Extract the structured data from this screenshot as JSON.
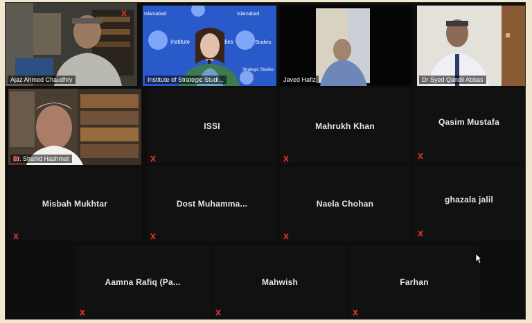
{
  "meeting": {
    "participants": [
      {
        "id": "p1",
        "name": "Ajaz Ahmed Chaudhry",
        "video": true
      },
      {
        "id": "p2",
        "name": "Institute of Strategic Studi...",
        "video": true,
        "active_speaker": true
      },
      {
        "id": "p3",
        "name": "Javed Hafiz",
        "video": true
      },
      {
        "id": "p4",
        "name": "Dr Syed Qandil Abbas",
        "video": true
      },
      {
        "id": "p5",
        "name": "Dr. Shahid Hashmat",
        "video": true,
        "muted": true
      },
      {
        "id": "p6",
        "name": "ISSI",
        "video": false,
        "muted": true
      },
      {
        "id": "p7",
        "name": "Mahrukh Khan",
        "video": false,
        "muted": true
      },
      {
        "id": "p8",
        "name": "Qasim Mustafa",
        "video": false,
        "muted": true
      },
      {
        "id": "p9",
        "name": "Misbah Mukhtar",
        "video": false,
        "muted": true
      },
      {
        "id": "p10",
        "name": "Dost Muhamma...",
        "video": false,
        "muted": true
      },
      {
        "id": "p11",
        "name": "Naela Chohan",
        "video": false,
        "muted": true
      },
      {
        "id": "p12",
        "name": "ghazala jalil",
        "video": false,
        "muted": true
      },
      {
        "id": "p13",
        "name": "Aamna Rafiq (Pa...",
        "video": false,
        "muted": true
      },
      {
        "id": "p14",
        "name": "Mahwish",
        "video": false,
        "muted": true
      },
      {
        "id": "p15",
        "name": "Farhan",
        "video": false,
        "muted": true
      }
    ]
  },
  "background_text": {
    "logo_text_1": "Institute",
    "logo_text_2": "Studies",
    "logo_text_3": "Strategic Studies",
    "banner_left": "Islamabad",
    "banner_right": "Islamabad"
  },
  "colors": {
    "active_border": "#c9e33b",
    "muted_icon": "#e0302b",
    "backdrop_blue": "#2a59c9"
  }
}
